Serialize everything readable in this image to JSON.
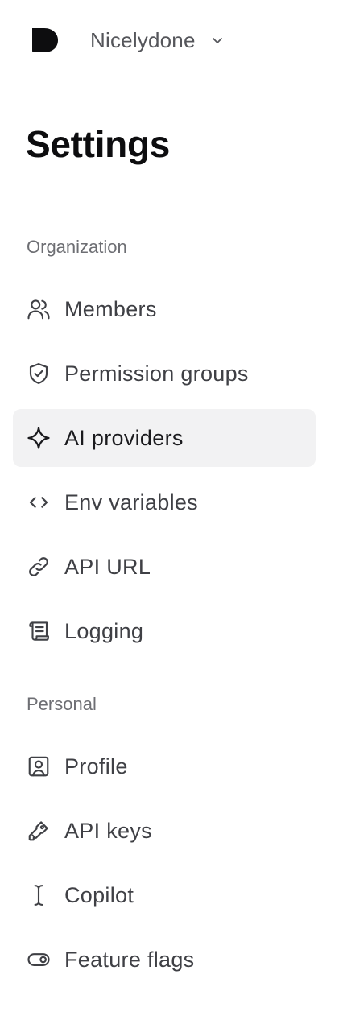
{
  "org": {
    "name": "Nicelydone",
    "logo_icon": "blob-logo-icon",
    "chevron_icon": "chevron-down-icon"
  },
  "page": {
    "title": "Settings"
  },
  "sections": {
    "organization": {
      "label": "Organization",
      "items": [
        {
          "label": "Members",
          "icon": "users-icon"
        },
        {
          "label": "Permission groups",
          "icon": "shield-check-icon"
        },
        {
          "label": "AI providers",
          "icon": "sparkle-icon",
          "active": true
        },
        {
          "label": "Env variables",
          "icon": "code-brackets-icon"
        },
        {
          "label": "API URL",
          "icon": "link-icon"
        },
        {
          "label": "Logging",
          "icon": "scroll-icon"
        }
      ]
    },
    "personal": {
      "label": "Personal",
      "items": [
        {
          "label": "Profile",
          "icon": "user-square-icon"
        },
        {
          "label": "API keys",
          "icon": "key-icon"
        },
        {
          "label": "Copilot",
          "icon": "text-cursor-icon"
        },
        {
          "label": "Feature flags",
          "icon": "toggle-icon"
        }
      ]
    }
  },
  "colors": {
    "active_bg": "#f2f2f3",
    "title": "#0d0d0f",
    "text": "#3f4045",
    "muted": "#6d6e73"
  }
}
